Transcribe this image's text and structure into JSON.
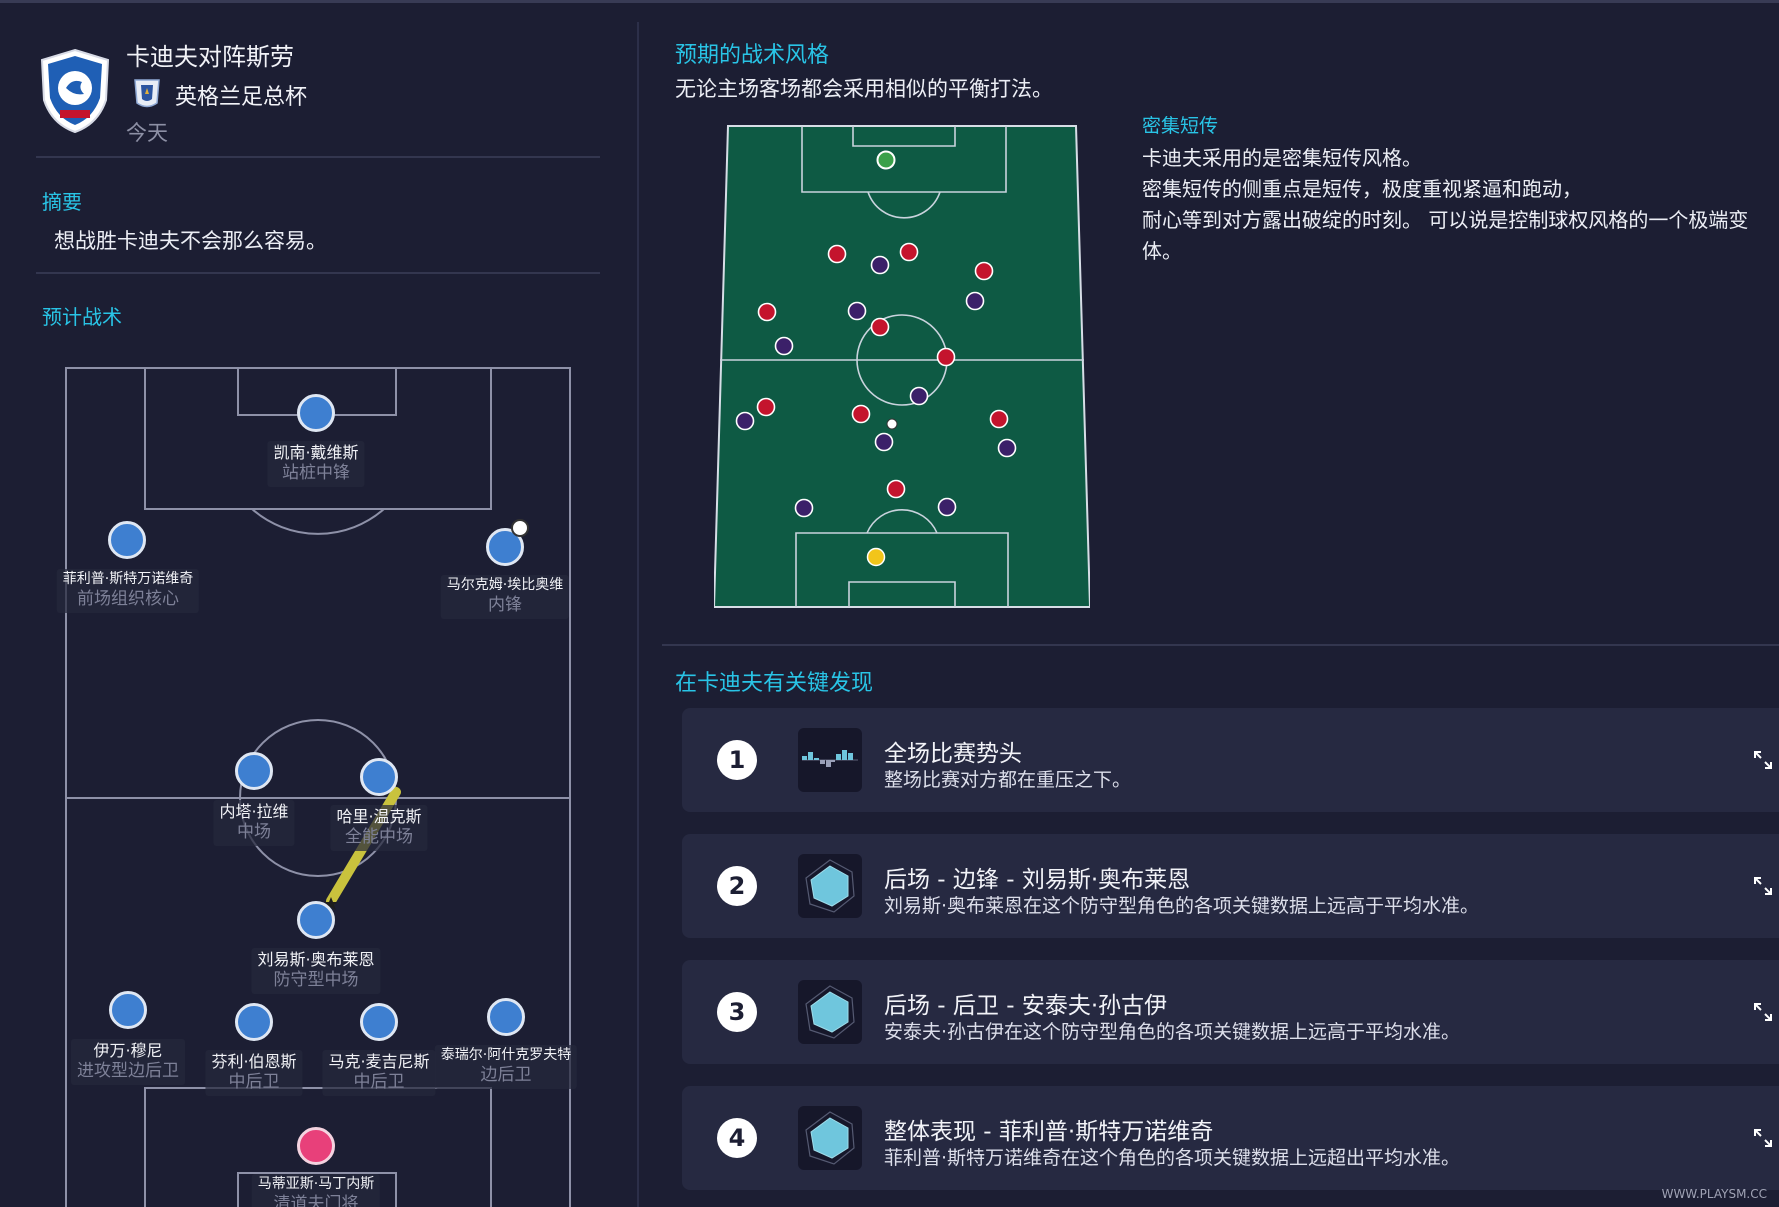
{
  "header": {
    "match_title": "卡迪夫对阵斯劳",
    "competition": "英格兰足总杯",
    "date": "今天"
  },
  "summary": {
    "title": "摘要",
    "text": "想战胜卡迪夫不会那么容易。"
  },
  "tactics": {
    "title": "预计战术",
    "players": [
      {
        "name": "凯南·戴维斯",
        "role": "站桩中锋"
      },
      {
        "name": "菲利普·斯特万诺维奇",
        "role": "前场组织核心"
      },
      {
        "name": "马尔克姆·埃比奥维",
        "role": "内锋"
      },
      {
        "name": "内塔·拉维",
        "role": "中场"
      },
      {
        "name": "哈里·温克斯",
        "role": "全能中场"
      },
      {
        "name": "刘易斯·奥布莱恩",
        "role": "防守型中场"
      },
      {
        "name": "伊万·穆尼",
        "role": "进攻型边后卫"
      },
      {
        "name": "芬利·伯恩斯",
        "role": "中后卫"
      },
      {
        "name": "马克·麦吉尼斯",
        "role": "中后卫"
      },
      {
        "name": "泰瑞尔·阿什克罗夫特",
        "role": "边后卫"
      },
      {
        "name": "马蒂亚斯·马丁内斯",
        "role": "清道夫门将"
      }
    ]
  },
  "style": {
    "title": "预期的战术风格",
    "description": "无论主场客场都会采用相似的平衡打法。",
    "sub_title": "密集短传",
    "sub_lines": [
      "卡迪夫采用的是密集短传风格。",
      "密集短传的侧重点是短传，极度重视紧逼和跑动，",
      "耐心等到对方露出破绽的时刻。 可以说是控制球权风格的一个极端变体。"
    ]
  },
  "findings": {
    "title": "在卡迪夫有关键发现",
    "items": [
      {
        "number": "1",
        "icon": "momentum-graph-icon",
        "title": "全场比赛势头",
        "desc": "整场比赛对方都在重压之下。"
      },
      {
        "number": "2",
        "icon": "radar-chart-icon",
        "title": "后场 - 边锋 - 刘易斯·奥布莱恩",
        "desc": "刘易斯·奥布莱恩在这个防守型角色的各项关键数据上远高于平均水准。"
      },
      {
        "number": "3",
        "icon": "radar-chart-icon",
        "title": "后场 - 后卫 - 安泰夫·孙古伊",
        "desc": "安泰夫·孙古伊在这个防守型角色的各项关键数据上远高于平均水准。"
      },
      {
        "number": "4",
        "icon": "radar-chart-icon",
        "title": "整体表现 - 菲利普·斯特万诺维奇",
        "desc": "菲利普·斯特万诺维奇在这个角色的各项关键数据上远超出平均水准。"
      }
    ]
  },
  "colors": {
    "accent": "#29c4e6",
    "background": "#1c1e33",
    "player_dot": "#3e7fd0",
    "goalkeeper_dot": "#e8407a",
    "mini_pitch": "#0e5a44",
    "home_marker": "#c4142d",
    "away_marker": "#3b2069"
  },
  "watermark": "WWW.PLAYSM.CC"
}
